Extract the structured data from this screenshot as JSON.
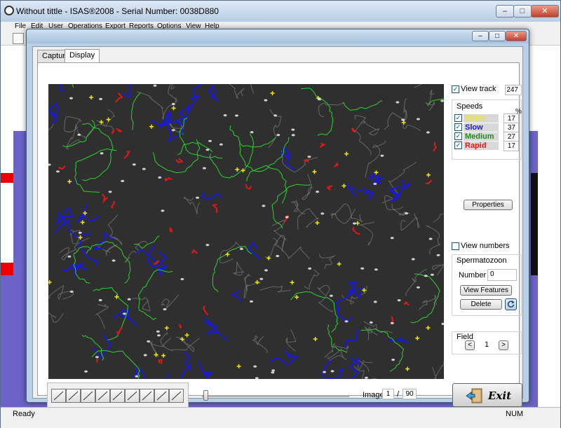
{
  "app": {
    "title": "Without tittle - ISAS®2008 - Serial Number: 0038D880",
    "menu": [
      "File",
      "Edit",
      "User",
      "Operations",
      "Export",
      "Reports",
      "Options",
      "View",
      "Help"
    ],
    "status_text": "Ready",
    "status_num": "NUM"
  },
  "dialog": {
    "tabs": [
      "Capture",
      "Display"
    ],
    "active_tab": "Display"
  },
  "track": {
    "view_track_label": "View track",
    "view_track_checked": true,
    "track_count": "247"
  },
  "speeds": {
    "title": "Speeds",
    "percent_label": "%",
    "items": [
      {
        "label": "Static",
        "value": "17",
        "color": "#f2e51a",
        "checked": true
      },
      {
        "label": "Slow",
        "value": "37",
        "color": "#1a1ad6",
        "checked": true
      },
      {
        "label": "Medium",
        "value": "27",
        "color": "#1e8c1e",
        "checked": true
      },
      {
        "label": "Rapid",
        "value": "17",
        "color": "#e01818",
        "checked": true
      }
    ]
  },
  "properties_label": "Properties",
  "view_numbers": {
    "label": "View numbers",
    "checked": false
  },
  "spermatozoon": {
    "title": "Spermatozoon",
    "number_label": "Number",
    "number_value": "0",
    "view_features_label": "View Features",
    "delete_label": "Delete"
  },
  "field": {
    "title": "Field",
    "value": "1",
    "prev": "<",
    "next": ">"
  },
  "image_nav": {
    "label": "Image",
    "current": "1",
    "separator": "/",
    "total": "90",
    "slider_fraction": 0.0
  },
  "exit_label": "Exit",
  "colors": {
    "static": "#f2e51a",
    "slow": "#1a1ad6",
    "medium": "#1e8c1e",
    "rapid": "#e01818",
    "background_image": "#2f2f2f"
  },
  "icons": [
    "app-logo-icon",
    "minimize-icon",
    "maximize-icon",
    "close-icon",
    "refresh-icon",
    "exit-door-icon"
  ]
}
